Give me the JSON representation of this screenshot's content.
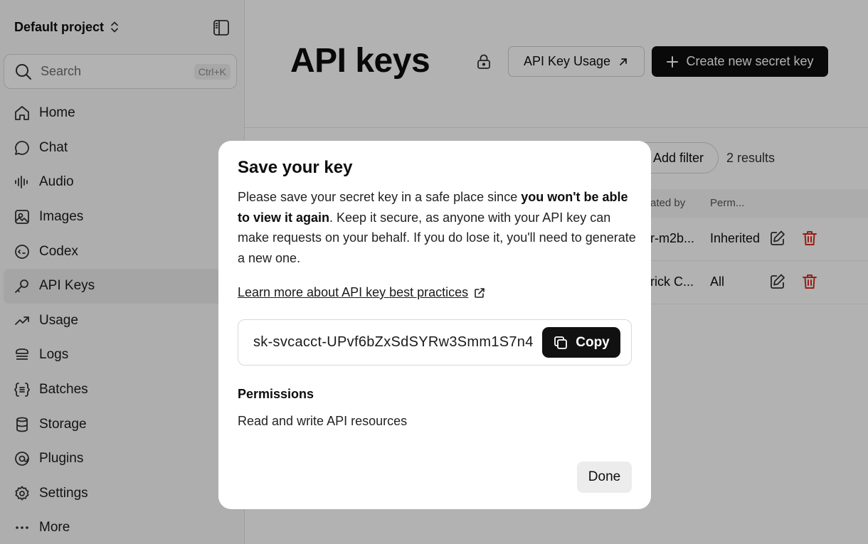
{
  "sidebar": {
    "project_name": "Default project",
    "search": {
      "label": "Search",
      "shortcut": "Ctrl+K"
    },
    "items": [
      {
        "label": "Home",
        "icon": "home-icon"
      },
      {
        "label": "Chat",
        "icon": "chat-icon"
      },
      {
        "label": "Audio",
        "icon": "audio-icon"
      },
      {
        "label": "Images",
        "icon": "images-icon"
      },
      {
        "label": "Codex",
        "icon": "codex-icon"
      },
      {
        "label": "API Keys",
        "icon": "key-icon",
        "active": true
      },
      {
        "label": "Usage",
        "icon": "usage-icon"
      },
      {
        "label": "Logs",
        "icon": "logs-icon"
      },
      {
        "label": "Batches",
        "icon": "batches-icon"
      },
      {
        "label": "Storage",
        "icon": "storage-icon"
      },
      {
        "label": "Plugins",
        "icon": "plugins-icon"
      },
      {
        "label": "Settings",
        "icon": "settings-icon"
      },
      {
        "label": "More",
        "icon": "more-icon"
      }
    ]
  },
  "header": {
    "title": "API keys",
    "usage_button": "API Key Usage",
    "create_button": "Create new secret key"
  },
  "table": {
    "filter_button": "Add filter",
    "results": "2 results",
    "columns": {
      "created_by": "ated by",
      "permissions": "Perm..."
    },
    "rows": [
      {
        "created_by": "r-m2b...",
        "permissions": "Inherited"
      },
      {
        "created_by": "rick C...",
        "permissions": "All"
      }
    ]
  },
  "modal": {
    "title": "Save your key",
    "desc_part1": "Please save your secret key in a safe place since ",
    "desc_bold": "you won't be able to view it again",
    "desc_part2": ". Keep it secure, as anyone with your API key can make requests on your behalf. If you do lose it, you'll need to generate a new one.",
    "link": "Learn more about API key best practices",
    "secret_key": "sk-svcacct-UPvf6bZxSdSYRw3Smm1S7n4",
    "copy_button": "Copy",
    "permissions_heading": "Permissions",
    "permissions_value": "Read and write API resources",
    "done_button": "Done"
  },
  "colors": {
    "danger": "#d92d20",
    "dark_button": "#0d0d0d"
  }
}
